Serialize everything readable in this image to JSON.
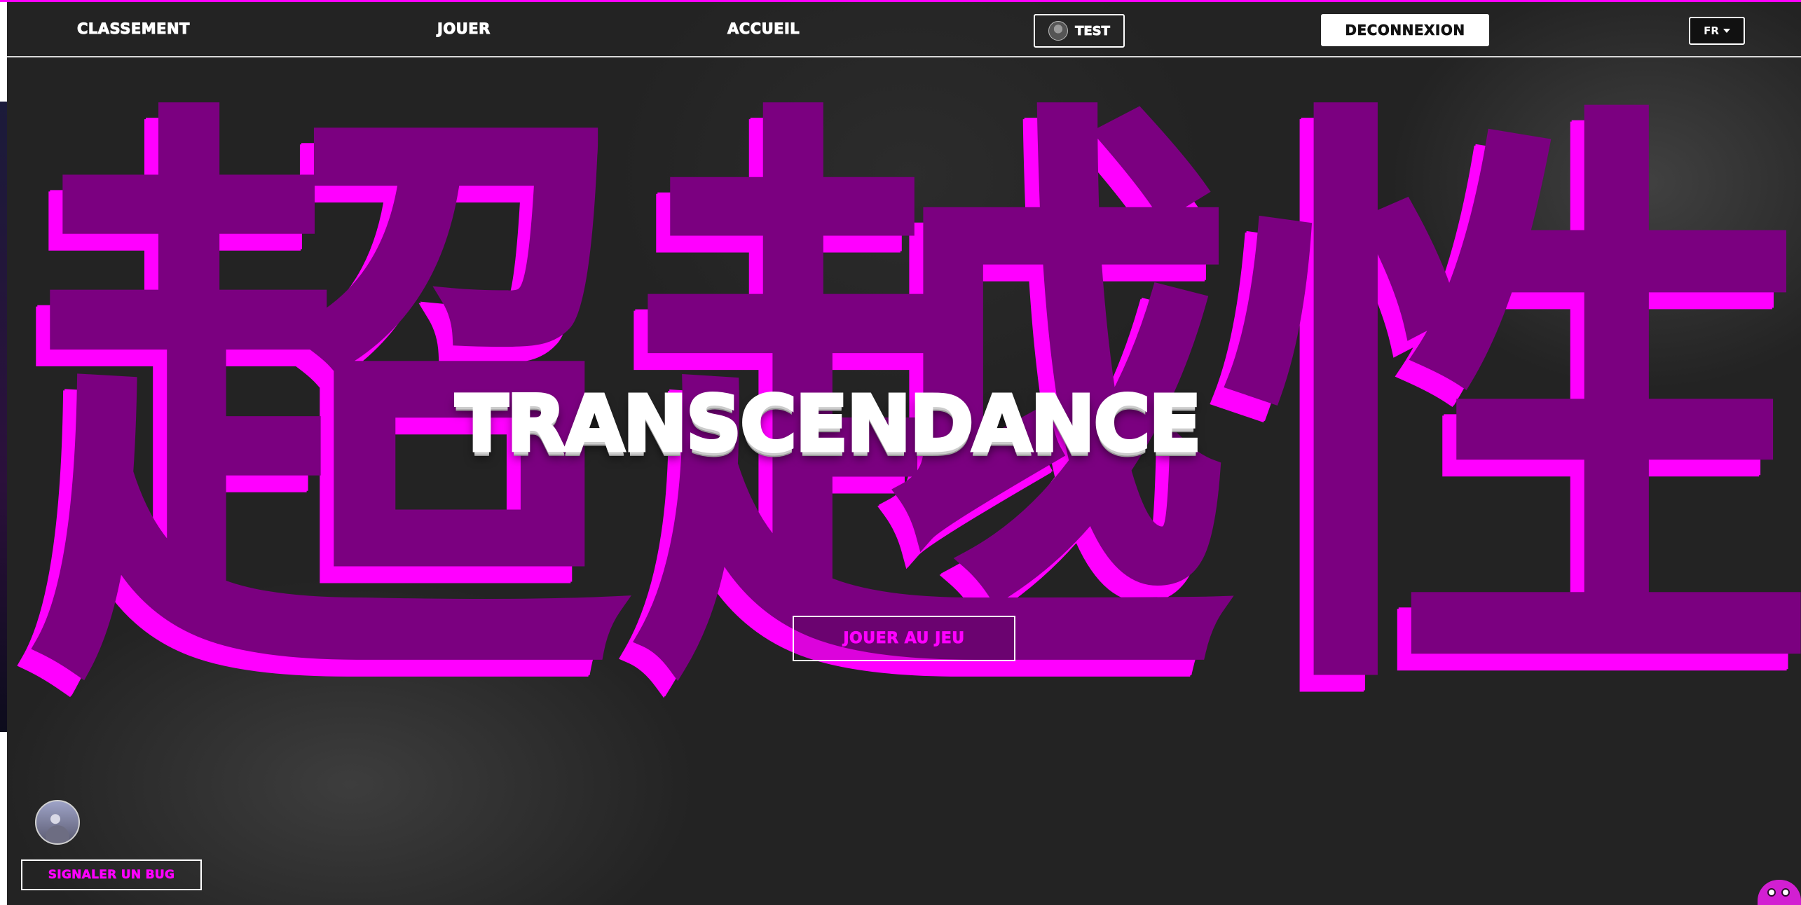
{
  "nav": {
    "links": [
      "CLASSEMENT",
      "JOUER",
      "ACCUEIL"
    ],
    "user_name": "TEST",
    "logout_label": "DECONNEXION",
    "language": "FR"
  },
  "hero": {
    "kanji": [
      "超",
      "越",
      "性"
    ],
    "title": "TRANSCENDANCE",
    "play_button": "JOUER AU JEU"
  },
  "footer": {
    "report_bug_label": "SIGNALER UN BUG"
  },
  "colors": {
    "accent": "#ff00ff",
    "kanji_fill": "#7b0080",
    "background": "#232323"
  },
  "icons": {
    "user_avatar": "avatar-icon",
    "language_caret": "caret-down-icon",
    "mascot": "mascot-icon"
  }
}
